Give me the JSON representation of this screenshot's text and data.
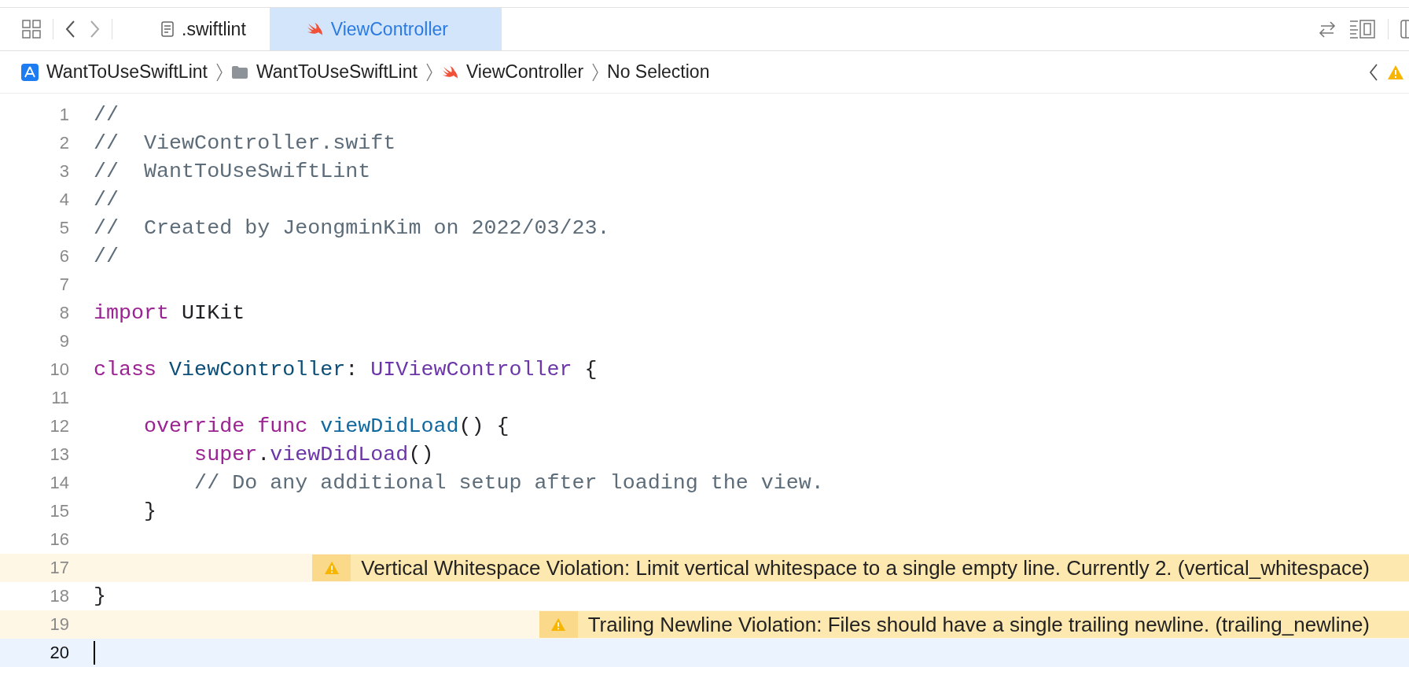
{
  "tabs": [
    {
      "label": ".swiftlint",
      "kind": "doc",
      "selected": false
    },
    {
      "label": "ViewController",
      "kind": "swift",
      "selected": true
    }
  ],
  "breadcrumb": [
    {
      "label": "WantToUseSwiftLint",
      "kind": "app"
    },
    {
      "label": "WantToUseSwiftLint",
      "kind": "folder"
    },
    {
      "label": "ViewController",
      "kind": "swift"
    },
    {
      "label": "No Selection",
      "kind": "none"
    }
  ],
  "lines": [
    {
      "number": "1",
      "current": false,
      "tokens": [
        {
          "text": "//",
          "kind": "comment"
        }
      ]
    },
    {
      "number": "2",
      "current": false,
      "tokens": [
        {
          "text": "//  ViewController.swift",
          "kind": "comment"
        }
      ]
    },
    {
      "number": "3",
      "current": false,
      "tokens": [
        {
          "text": "//  WantToUseSwiftLint",
          "kind": "comment"
        }
      ]
    },
    {
      "number": "4",
      "current": false,
      "tokens": [
        {
          "text": "//",
          "kind": "comment"
        }
      ]
    },
    {
      "number": "5",
      "current": false,
      "tokens": [
        {
          "text": "//  Created by JeongminKim on 2022/03/23.",
          "kind": "comment"
        }
      ]
    },
    {
      "number": "6",
      "current": false,
      "tokens": [
        {
          "text": "//",
          "kind": "comment"
        }
      ]
    },
    {
      "number": "7",
      "current": false
    },
    {
      "number": "8",
      "current": false,
      "tokens": [
        {
          "text": "import",
          "kind": "keyword"
        },
        {
          "text": " UIKit",
          "kind": "plain"
        }
      ]
    },
    {
      "number": "9",
      "current": false
    },
    {
      "number": "10",
      "current": false,
      "tokens": [
        {
          "text": "class",
          "kind": "keyword"
        },
        {
          "text": " ViewController",
          "kind": "decl"
        },
        {
          "text": ":",
          "kind": "plain"
        },
        {
          "text": " UIViewController",
          "kind": "type"
        },
        {
          "text": " {",
          "kind": "plain"
        }
      ]
    },
    {
      "number": "11",
      "current": false
    },
    {
      "number": "12",
      "current": false,
      "tokens": [
        {
          "text": "    override",
          "kind": "keyword"
        },
        {
          "text": " func",
          "kind": "keyword"
        },
        {
          "text": " viewDidLoad",
          "kind": "funcdecl"
        },
        {
          "text": "() {",
          "kind": "plain"
        }
      ]
    },
    {
      "number": "13",
      "current": false,
      "tokens": [
        {
          "text": "        super",
          "kind": "keyword"
        },
        {
          "text": ".",
          "kind": "plain"
        },
        {
          "text": "viewDidLoad",
          "kind": "type"
        },
        {
          "text": "()",
          "kind": "plain"
        }
      ]
    },
    {
      "number": "14",
      "current": false,
      "tokens": [
        {
          "text": "        // Do any additional setup after loading the view.",
          "kind": "comment"
        }
      ]
    },
    {
      "number": "15",
      "current": false,
      "tokens": [
        {
          "text": "    }",
          "kind": "plain"
        }
      ]
    },
    {
      "number": "16",
      "current": false
    },
    {
      "number": "17",
      "current": false,
      "warning": "Vertical Whitespace Violation: Limit vertical whitespace to a single empty line. Currently 2. (vertical_whitespace)"
    },
    {
      "number": "18",
      "current": false,
      "tokens": [
        {
          "text": "}",
          "kind": "plain"
        }
      ]
    },
    {
      "number": "19",
      "current": false,
      "warning": "Trailing Newline Violation: Files should have a single trailing newline. (trailing_newline)"
    },
    {
      "number": "20",
      "current": true
    }
  ]
}
